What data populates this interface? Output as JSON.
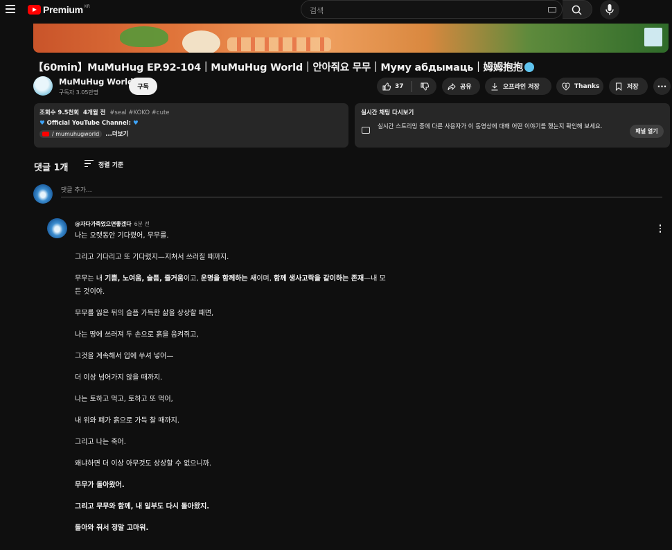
{
  "header": {
    "logo_text": "Premium",
    "logo_region": "KR",
    "search_placeholder": "검색"
  },
  "video": {
    "title": "【60min】MuMuHug EP.92-104｜MuMuHug World｜안아줘요 무무｜Муму абдымаць｜姆姆抱抱",
    "channel_name": "MuMuHug World",
    "subscribers": "구독자 3.05만명",
    "subscribe_label": "구독",
    "like_count": "37",
    "share_label": "공유",
    "offline_label": "오프라인 저장",
    "thanks_label": "Thanks",
    "save_label": "저장",
    "more_label": "···"
  },
  "description": {
    "views": "조회수 9.5천회",
    "date": "4개월 전",
    "tags": "#seal #KOKO #cute",
    "line2": "Official YouTube Channel:",
    "link_label": "/ mumuhugworld",
    "more": "...더보기"
  },
  "live_chat": {
    "title": "실시간 채팅 다시보기",
    "body": "실시간 스트리밍 중에 다른 사용자가 이 동영상에 대해 어떤 이야기를 했는지 확인해 보세요.",
    "button": "패널 열기"
  },
  "comments": {
    "count_label": "댓글 1개",
    "sort_label": "정렬 기준",
    "add_placeholder": "댓글 추가...",
    "items": [
      {
        "author": "@자다가죽었으면좋겠다",
        "time": "6분 전",
        "lines": [
          "나는 오랫동안 기다렸어, 무무를.",
          "그리고 기다리고 또 기다렸지—지쳐서 쓰러질 때까지.",
          "무무는 내 ",
          "기쁨, 노여움, 슬픔, 즐거움",
          "이고, ",
          "운명을 함께하는 새",
          "이며, ",
          "함께 생사고락을 같이하는 존재",
          "—내 모",
          "든 것이야.",
          "무무를 잃은 뒤의 슬픔 가득한 삶을 상상할 때면,",
          "나는 땅에 쓰러져 두 손으로 흙을 움켜쥐고,",
          "그것을 계속해서 입에 쑤셔 넣어—",
          "더 이상 넘어가지 않을 때까지.",
          "나는 토하고 먹고, 토하고 또 먹어,",
          "내 위와 폐가 흙으로 가득 찰 때까지.",
          "그리고 나는 죽어.",
          "왜냐하면 더 이상 아무것도 상상할 수 없으니까.",
          "무무가 돌아왔어.",
          "그리고 무무와 함께, 내 일부도 다시 돌아왔지.",
          "돌아와 줘서 정말 고마워."
        ]
      }
    ]
  }
}
